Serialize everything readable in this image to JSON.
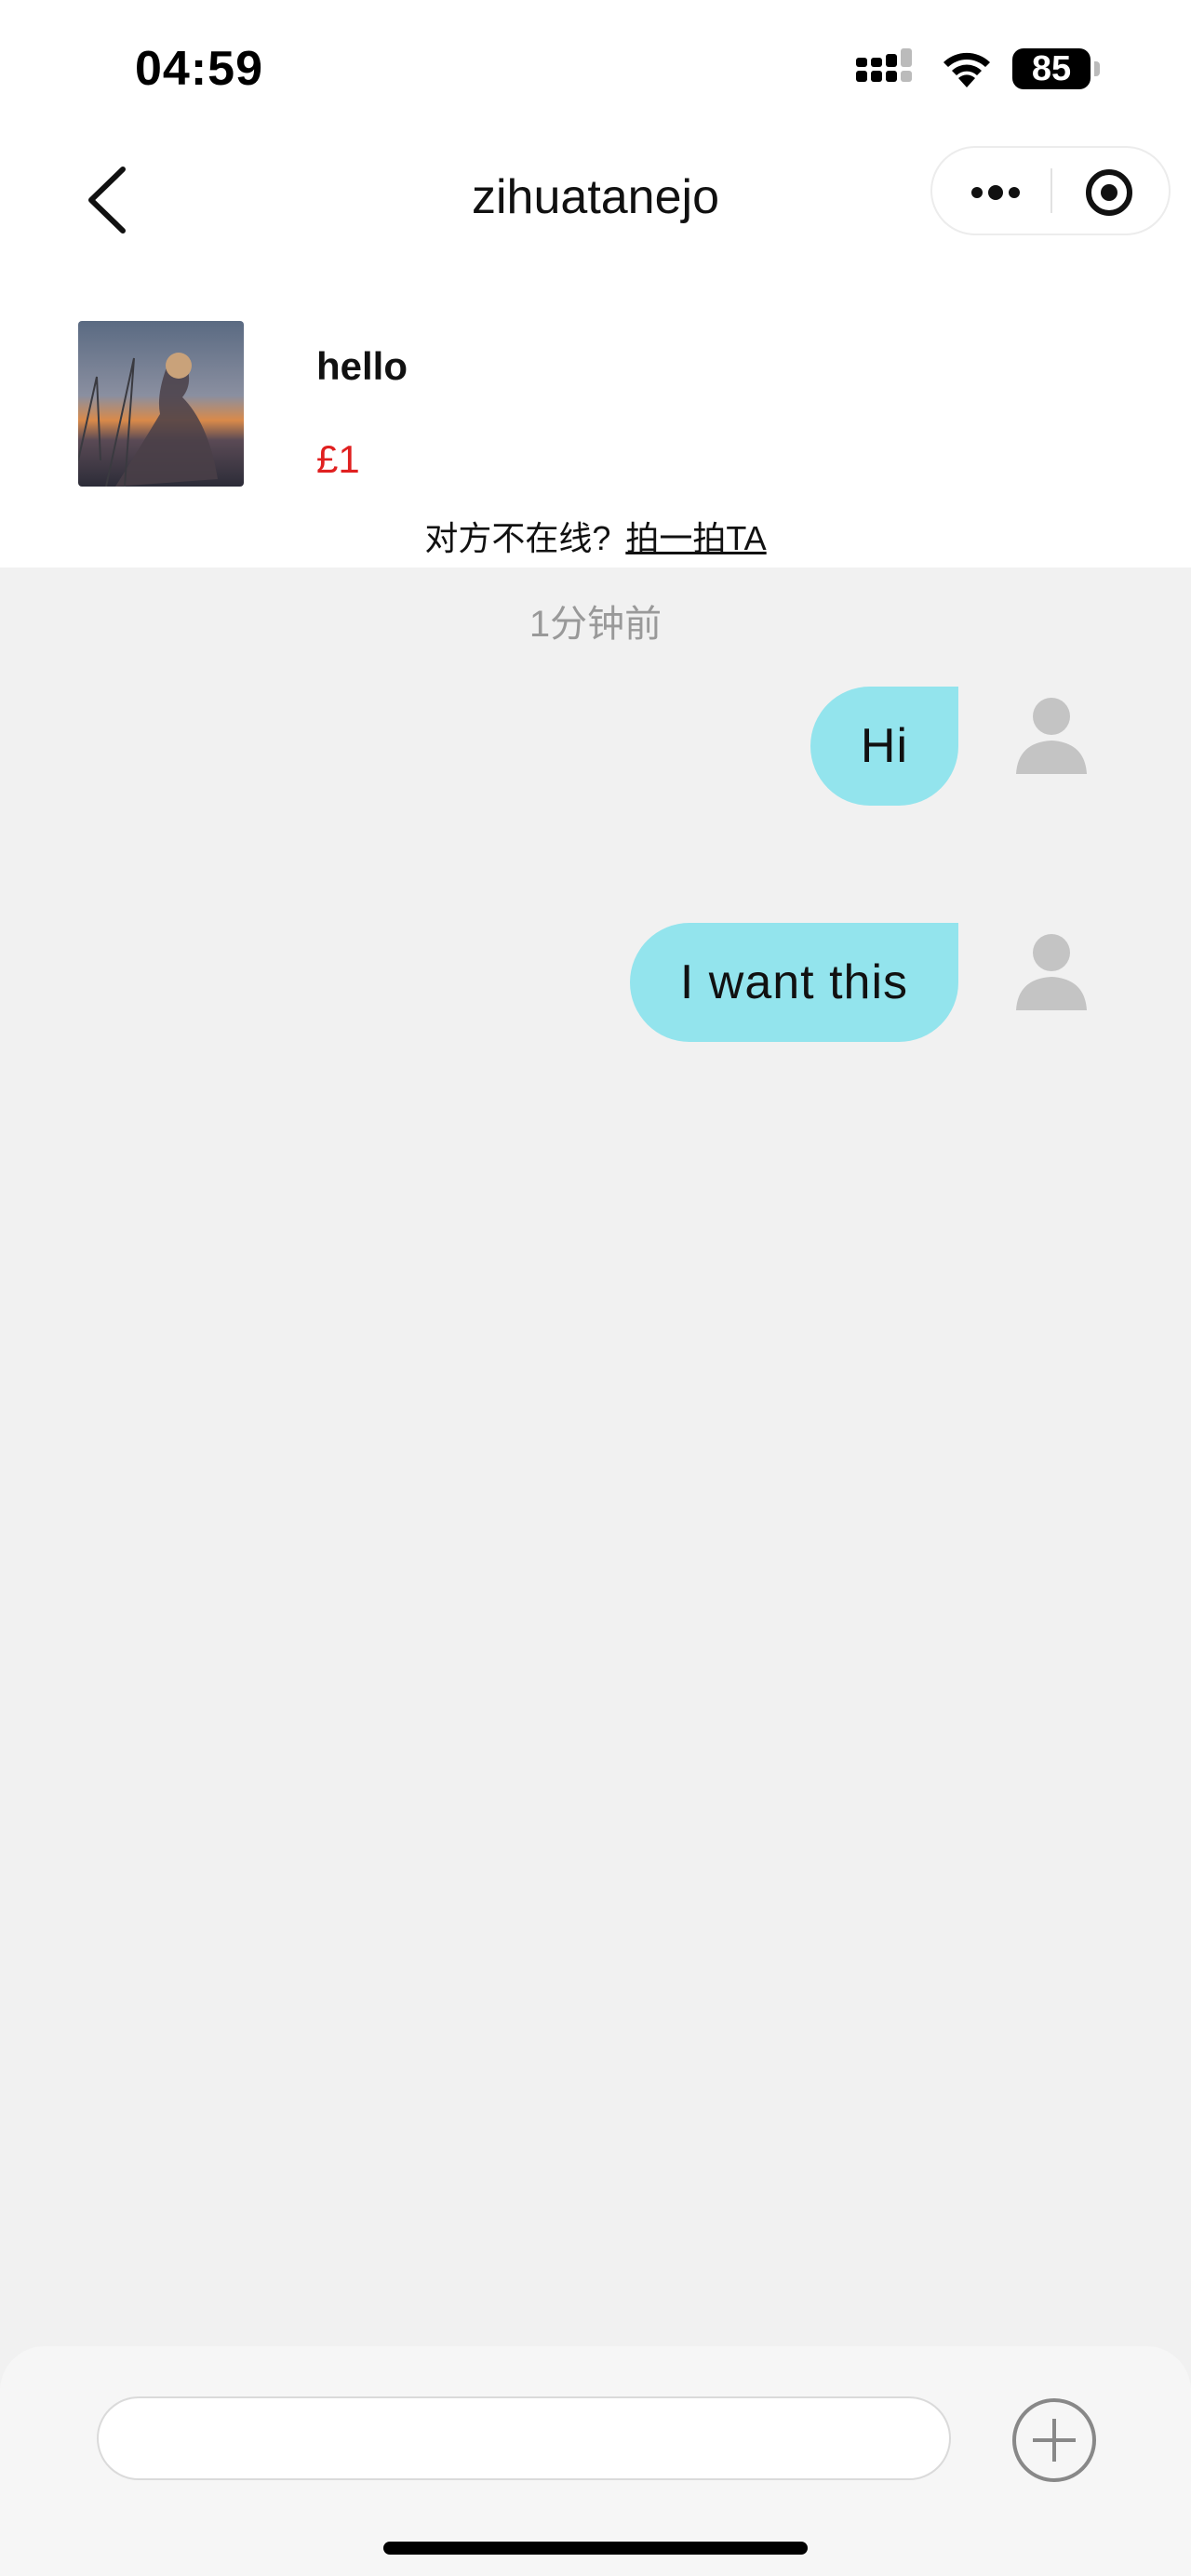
{
  "status_bar": {
    "time": "04:59",
    "battery": "85"
  },
  "nav": {
    "title": "zihuatanejo"
  },
  "product": {
    "title": "hello",
    "price": "£1"
  },
  "offline_notice": {
    "text": "对方不在线?",
    "poke_link": "拍一拍TA"
  },
  "chat": {
    "timestamp": "1分钟前",
    "messages": [
      {
        "text": "Hi",
        "sender": "self"
      },
      {
        "text": "I want this",
        "sender": "self"
      }
    ]
  },
  "input": {
    "value": "",
    "placeholder": ""
  },
  "colors": {
    "bubble": "#93e4ed",
    "price": "#e02020",
    "chat_bg": "#f1f1f1"
  }
}
